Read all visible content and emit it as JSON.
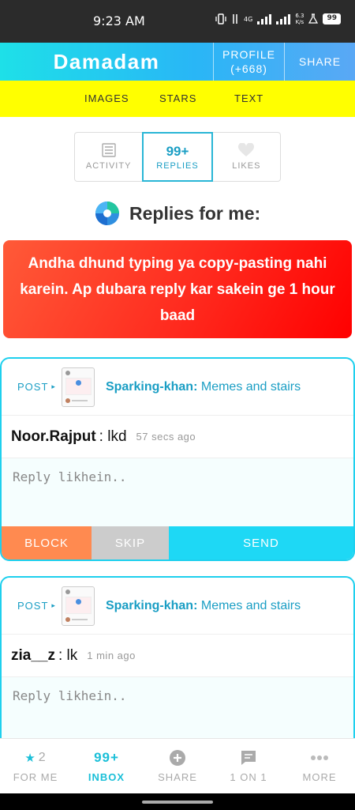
{
  "status": {
    "time": "9:23 AM",
    "net": "4G",
    "speed_value": "6.3",
    "speed_unit": "K/s",
    "battery": "99"
  },
  "header": {
    "brand": "Damadam",
    "profile_label": "PROFILE",
    "profile_count": "(+668)",
    "share_label": "SHARE"
  },
  "nav": {
    "items": [
      "IMAGES",
      "STARS",
      "TEXT"
    ]
  },
  "tabs": {
    "activity": "ACTIVITY",
    "replies_count": "99+",
    "replies": "REPLIES",
    "likes": "LIKES"
  },
  "heading": "Replies for me:",
  "warning": "Andha dhund typing ya copy-pasting nahi karein. Ap dubara reply kar sakein ge 1 hour baad",
  "replies": [
    {
      "post_label": "POST",
      "author": "Sparking-khan:",
      "title": "Memes and stairs",
      "user": "Noor.Rajput",
      "text": ": lkd",
      "ago": "57 secs ago",
      "placeholder": "Reply likhein..",
      "block": "BLOCK",
      "skip": "SKIP",
      "send": "SEND"
    },
    {
      "post_label": "POST",
      "author": "Sparking-khan:",
      "title": "Memes and stairs",
      "user": "zia__z",
      "text": ": lk",
      "ago": "1 min ago",
      "placeholder": "Reply likhein.."
    }
  ],
  "bottom_nav": {
    "for_me_count": "2",
    "for_me": "FOR ME",
    "inbox_count": "99+",
    "inbox": "INBOX",
    "share": "SHARE",
    "one_on_one": "1 ON 1",
    "more": "MORE"
  },
  "colors": {
    "accent": "#1ed0ee",
    "nav_yellow": "#ffff00",
    "warning_red": "#ff2a1e",
    "block_orange": "#ff8a50"
  }
}
